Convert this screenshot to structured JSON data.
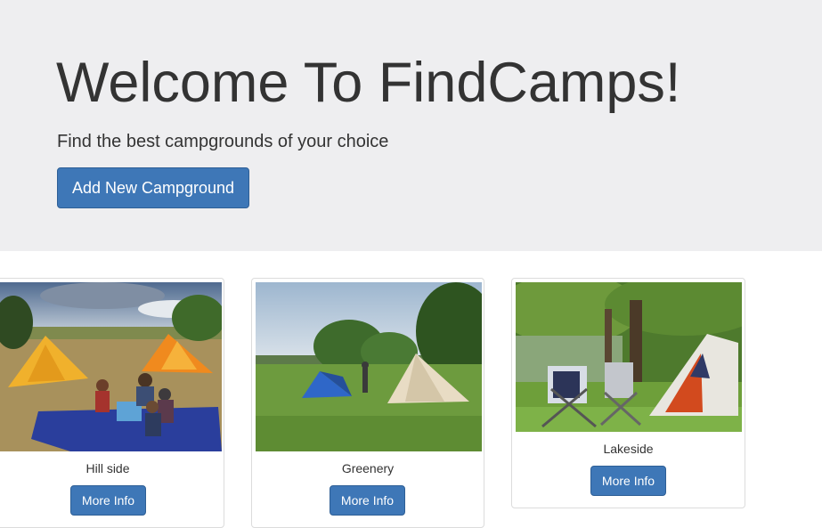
{
  "jumbotron": {
    "title": "Welcome To FindCamps!",
    "subtitle": "Find the best campgrounds of your choice",
    "add_button_label": "Add New Campground"
  },
  "campgrounds": [
    {
      "name": "Hill side",
      "button_label": "More Info"
    },
    {
      "name": "Greenery",
      "button_label": "More Info"
    },
    {
      "name": "Lakeside",
      "button_label": "More Info"
    }
  ],
  "colors": {
    "jumbotron_bg": "#eeeef0",
    "primary_button": "#3e77b7",
    "text": "#333333"
  }
}
